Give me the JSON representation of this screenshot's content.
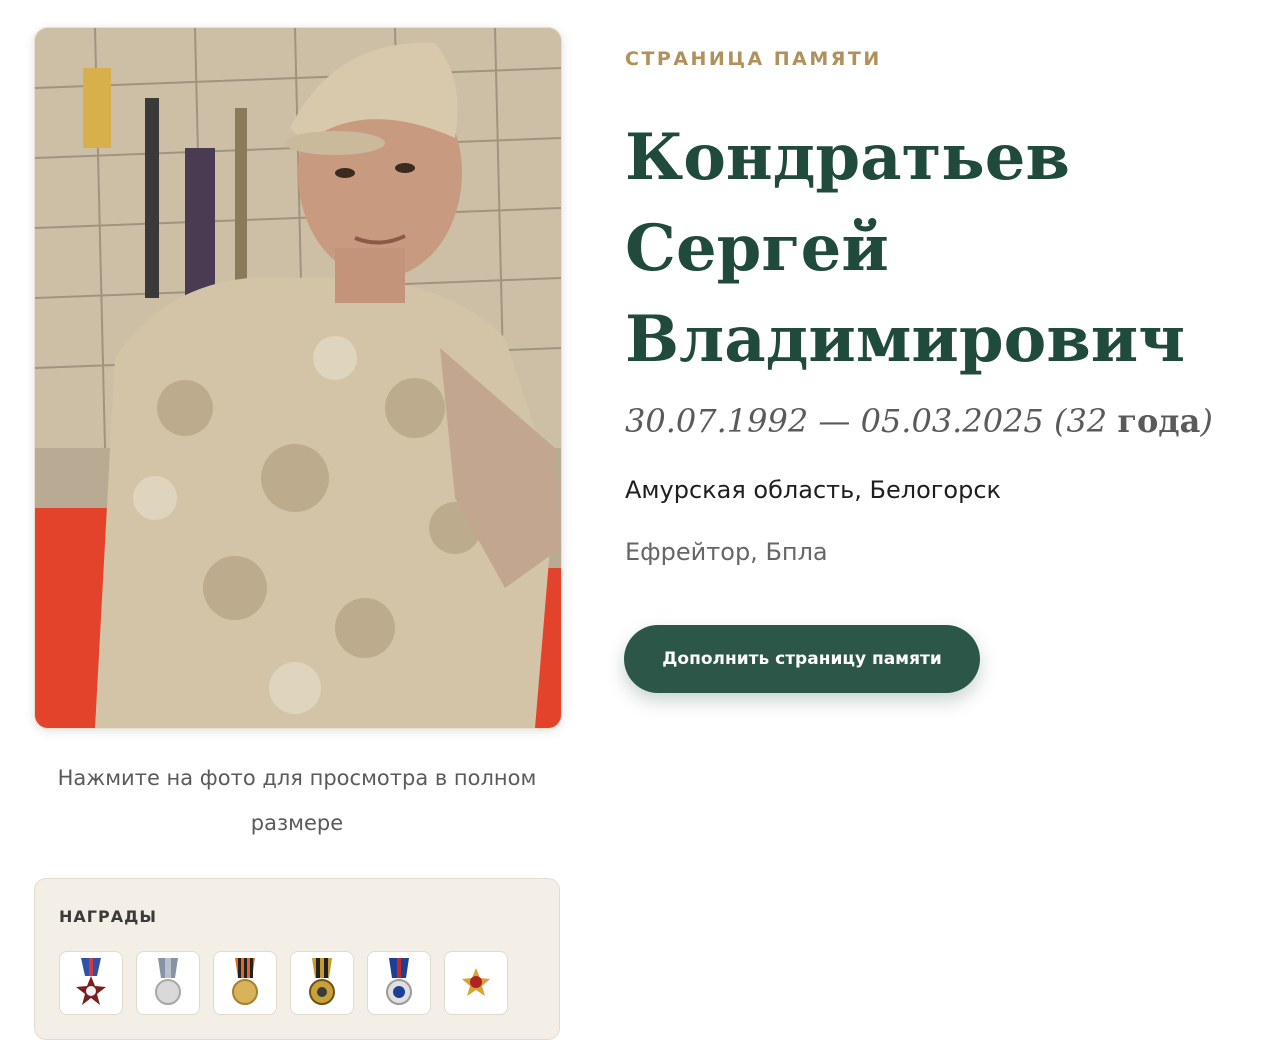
{
  "page": {
    "kicker": "СТРАНИЦА ПАМЯТИ",
    "name_line1": "Кондратьев",
    "name_line2": "Сергей",
    "name_line3": "Владимирович",
    "dates_range": "30.07.1992 — 05.03.2025",
    "age_prefix": "(32 ",
    "age_word": "года",
    "age_suffix": ")",
    "location": "Амурская область, Белогорск",
    "rank": "Ефрейтор, Бпла",
    "add_button": "Дополнить страницу памяти"
  },
  "photo": {
    "caption": "Нажмите на фото для просмотра в полном размере"
  },
  "awards": {
    "title": "НАГРАДЫ",
    "items": [
      {
        "icon": "medal-star-icon",
        "ribbon": "#2f4fa8"
      },
      {
        "icon": "medal-silver-icon",
        "ribbon": "#8793a5"
      },
      {
        "icon": "medal-st-george-icon",
        "ribbon": "#e06a1f"
      },
      {
        "icon": "medal-gold-icon",
        "ribbon": "#c69a2b"
      },
      {
        "icon": "medal-blue-icon",
        "ribbon": "#1d3f94"
      },
      {
        "icon": "badge-eagle-icon",
        "ribbon": "#b22222"
      }
    ]
  },
  "colors": {
    "accent_green": "#1f4a3c",
    "kicker_gold": "#b0915b",
    "button_bg": "#2b5648"
  }
}
